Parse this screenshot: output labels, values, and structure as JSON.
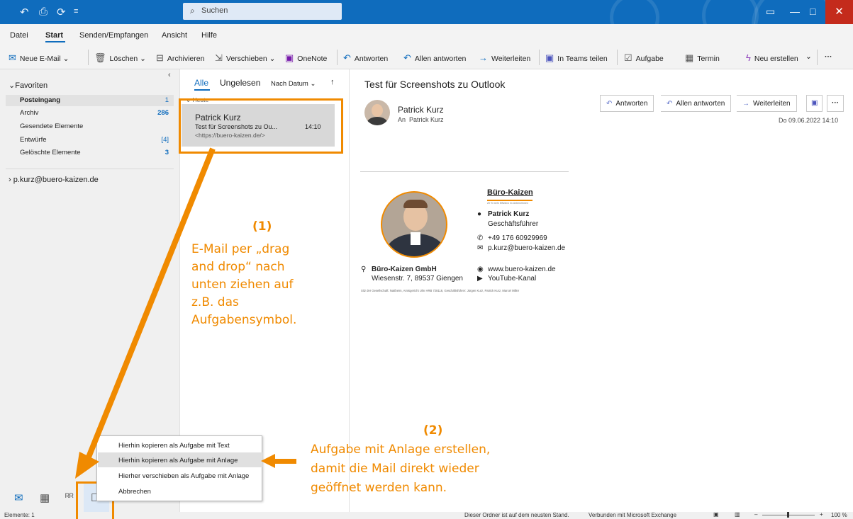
{
  "titlebar": {
    "search_placeholder": "Suchen"
  },
  "menu": [
    "Datei",
    "Start",
    "Senden/Empfangen",
    "Ansicht",
    "Hilfe"
  ],
  "toolbar": {
    "new_email": "Neue E-Mail",
    "delete": "Löschen",
    "archive": "Archivieren",
    "move": "Verschieben",
    "onenote": "OneNote",
    "reply": "Antworten",
    "reply_all": "Allen antworten",
    "forward": "Weiterleiten",
    "teams_share": "In Teams teilen",
    "task": "Aufgabe",
    "appointment": "Termin",
    "create_new": "Neu erstellen",
    "more": "···"
  },
  "folders": {
    "favorites_label": "Favoriten",
    "items": [
      {
        "name": "Posteingang",
        "count": "1"
      },
      {
        "name": "Archiv",
        "count": "286"
      },
      {
        "name": "Gesendete Elemente",
        "count": ""
      },
      {
        "name": "Entwürfe",
        "count": "[4]"
      },
      {
        "name": "Gelöschte Elemente",
        "count": "3"
      }
    ],
    "account": "p.kurz@buero-kaizen.de"
  },
  "list": {
    "tab_all": "Alle",
    "tab_unread": "Ungelesen",
    "sort": "Nach Datum",
    "group": "Heute",
    "mail": {
      "sender": "Patrick Kurz",
      "subject": "Test für Screenshots zu Ou...",
      "time": "14:10",
      "preview": "<https://buero-kaizen.de/>"
    }
  },
  "reading": {
    "subject": "Test für Screenshots zu Outlook",
    "sender": "Patrick Kurz",
    "to_label": "An",
    "to": "Patrick Kurz",
    "date": "Do 09.06.2022 14:10",
    "btn_reply": "Antworten",
    "btn_reply_all": "Allen antworten",
    "btn_forward": "Weiterleiten",
    "more": "···"
  },
  "signature": {
    "brand": "Büro-Kaizen",
    "tagline": "20 % mehr Effizienz im Unternehmen",
    "name": "Patrick Kurz",
    "role": "Geschäftsführer",
    "phone": "+49 176 60929969",
    "email": "p.kurz@buero-kaizen.de",
    "company": "Büro-Kaizen GmbH",
    "address": "Wiesenstr. 7, 89537 Giengen",
    "web": "www.buero-kaizen.de",
    "youtube": "YouTube-Kanal",
    "legal": "Sitz der Gesellschaft: Nattheim, Amtsgericht Ulm HRB 728116, Geschäftsführer: Jürgen Kurz, Patrick Kurz, Marcel Miller"
  },
  "context_menu": [
    {
      "label": "Hierhin kopieren als Aufgabe mit Text"
    },
    {
      "label": "Hierhin kopieren als Aufgabe mit Anlage"
    },
    {
      "label": "Hierher verschieben als Aufgabe mit Anlage"
    },
    {
      "label": "Abbrechen"
    }
  ],
  "annotations": {
    "step1_num": "(1)",
    "step1_lines": [
      "E-Mail per „drag",
      "and drop“ nach",
      "unten ziehen auf",
      "z.B. das",
      "Aufgabensymbol."
    ],
    "step2_num": "(2)",
    "step2_lines": [
      "Aufgabe mit Anlage erstellen,",
      "damit die Mail direkt wieder",
      "geöffnet werden kann."
    ]
  },
  "statusbar": {
    "items": "Elemente: 1",
    "sync": "Dieser Ordner ist auf dem neusten Stand.",
    "connection": "Verbunden mit Microsoft Exchange",
    "zoom": "100 %"
  },
  "colors": {
    "accent": "#0f6cbd",
    "annotation": "#f08a00"
  }
}
